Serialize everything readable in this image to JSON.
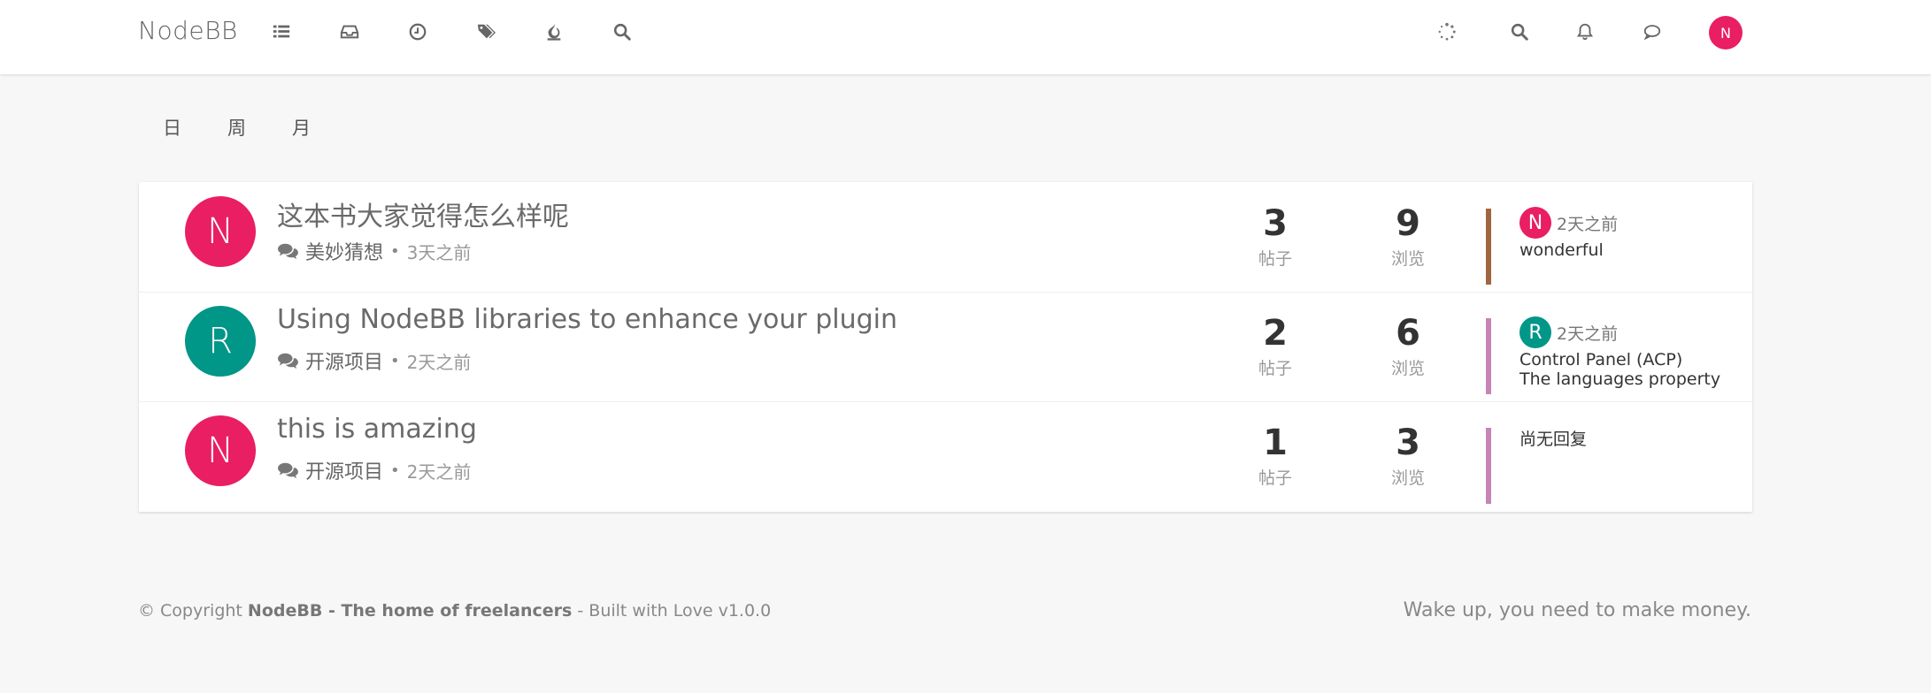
{
  "header": {
    "brand": "NodeBB",
    "nav_icons": [
      "categories-icon",
      "unread-icon",
      "recent-icon",
      "tags-icon",
      "popular-icon",
      "search-icon"
    ],
    "right_icons": [
      "loading-icon",
      "search-icon",
      "bell-icon",
      "chat-icon"
    ],
    "user_avatar_letter": "N",
    "user_avatar_color": "#e91e63"
  },
  "period_tabs": [
    "日",
    "周",
    "月"
  ],
  "topics": [
    {
      "avatar_letter": "N",
      "avatar_color": "#e91e63",
      "title": "这本书大家觉得怎么样呢",
      "category": "美妙猜想",
      "dot": "•",
      "time": "3天之前",
      "posts": "3",
      "posts_label": "帖子",
      "views": "9",
      "views_label": "浏览",
      "category_color": "#a0663f",
      "teaser": {
        "avatar_letter": "N",
        "avatar_color": "#e91e63",
        "time": "2天之前",
        "text": "wonderful"
      }
    },
    {
      "avatar_letter": "R",
      "avatar_color": "#009688",
      "title": "Using NodeBB libraries to enhance your plugin",
      "category": "开源项目",
      "dot": "•",
      "time": "2天之前",
      "posts": "2",
      "posts_label": "帖子",
      "views": "6",
      "views_label": "浏览",
      "category_color": "#c784b6",
      "teaser": {
        "avatar_letter": "R",
        "avatar_color": "#009688",
        "time": "2天之前",
        "text_line1": "Control Panel (ACP)",
        "text_line2": "The languages property"
      }
    },
    {
      "avatar_letter": "N",
      "avatar_color": "#e91e63",
      "title": "this is amazing",
      "category": "开源项目",
      "dot": "•",
      "time": "2天之前",
      "posts": "1",
      "posts_label": "帖子",
      "views": "3",
      "views_label": "浏览",
      "category_color": "#c784b6",
      "teaser": {
        "empty_text": "尚无回复"
      }
    }
  ],
  "footer": {
    "copyright_prefix": "© Copyright ",
    "site_name": "NodeBB - The home of freelancers",
    "suffix": " - Built with Love v1.0.0",
    "tagline": "Wake up, you need to make money."
  }
}
